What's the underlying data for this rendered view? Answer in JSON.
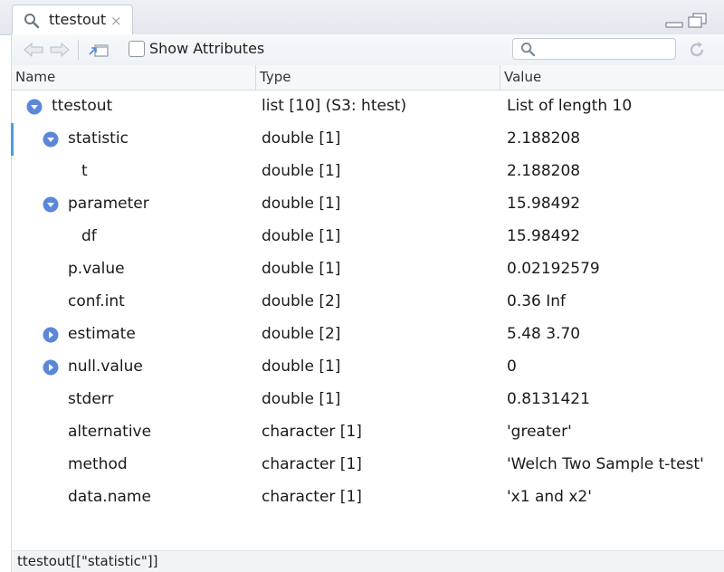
{
  "tab": {
    "title": "ttestout",
    "icon": "search-icon",
    "close_glyph": "×"
  },
  "toolbar": {
    "show_attributes_label": "Show Attributes",
    "show_attributes_checked": false,
    "filter": {
      "value": "",
      "placeholder": ""
    }
  },
  "columns": {
    "name": "Name",
    "type": "Type",
    "value": "Value"
  },
  "rows": [
    {
      "name": "ttestout",
      "type": "list [10] (S3: htest)",
      "value": "List of length 10",
      "expander": "collapse"
    },
    {
      "name": "statistic",
      "type": "double [1]",
      "value": "2.188208",
      "expander": "collapse"
    },
    {
      "name": "t",
      "type": "double [1]",
      "value": "2.188208",
      "expander": "none"
    },
    {
      "name": "parameter",
      "type": "double [1]",
      "value": "15.98492",
      "expander": "collapse"
    },
    {
      "name": "df",
      "type": "double [1]",
      "value": "15.98492",
      "expander": "none"
    },
    {
      "name": "p.value",
      "type": "double [1]",
      "value": "0.02192579",
      "expander": "none"
    },
    {
      "name": "conf.int",
      "type": "double [2]",
      "value": "0.36 Inf",
      "expander": "none"
    },
    {
      "name": "estimate",
      "type": "double [2]",
      "value": "5.48 3.70",
      "expander": "expand"
    },
    {
      "name": "null.value",
      "type": "double [1]",
      "value": "0",
      "expander": "expand"
    },
    {
      "name": "stderr",
      "type": "double [1]",
      "value": "0.8131421",
      "expander": "none"
    },
    {
      "name": "alternative",
      "type": "character [1]",
      "value": "'greater'",
      "expander": "none"
    },
    {
      "name": "method",
      "type": "character [1]",
      "value": "'Welch Two Sample t-test'",
      "expander": "none"
    },
    {
      "name": "data.name",
      "type": "character [1]",
      "value": "'x1 and x2'",
      "expander": "none"
    }
  ],
  "selected_row": "statistic",
  "status": {
    "expression": "ttestout[[\"statistic\"]]"
  },
  "colors": {
    "expander": "#5b87d9",
    "selection": "#4a9ee0",
    "header_bg": "#f5f7f9"
  }
}
